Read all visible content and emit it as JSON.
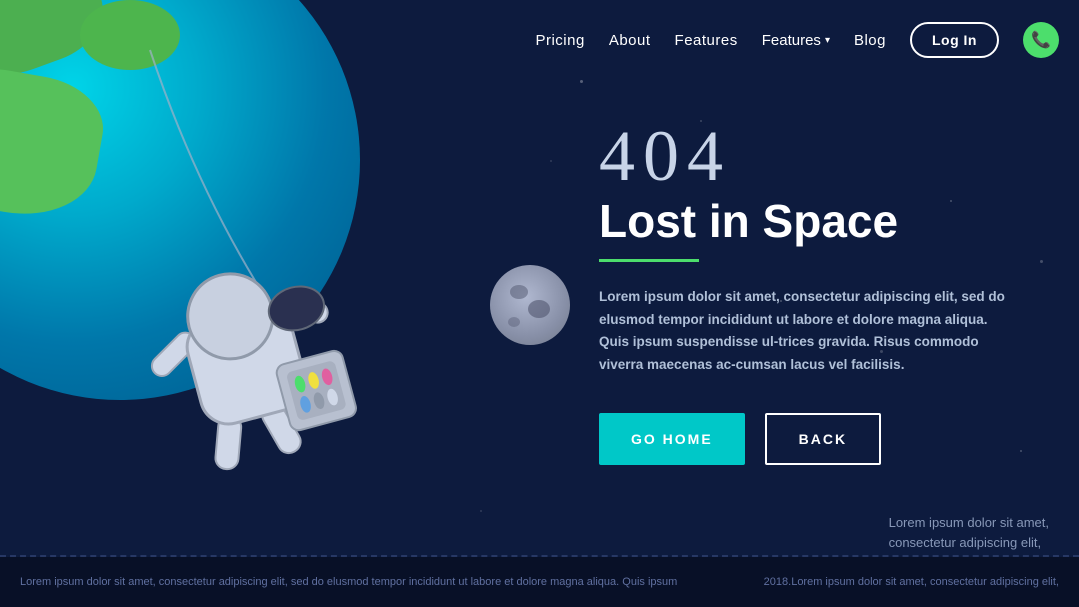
{
  "nav": {
    "links": [
      {
        "label": "Pricing",
        "id": "pricing"
      },
      {
        "label": "About",
        "id": "about"
      },
      {
        "label": "Features",
        "id": "features"
      },
      {
        "label": "Features",
        "id": "features-dropdown",
        "hasDropdown": true
      },
      {
        "label": "Blog",
        "id": "blog"
      }
    ],
    "login_label": "Log In",
    "phone_icon": "📞"
  },
  "hero": {
    "error_code": "404",
    "title": "Lost in Space",
    "description": "Lorem ipsum dolor sit amet, consectetur adipiscing elit, sed do elusmod tempor incididunt ut labore et dolore magna aliqua. Quis ipsum suspendisse ultrices gravida. Risus commodo viverra maecenas accumsan lacus vel facilisis.",
    "btn_home": "GO  HOME",
    "btn_back": "BACK"
  },
  "footer": {
    "left_text": "Lorem ipsum dolor sit amet, consectetur adipiscing elit, sed do elusmod tempor incididunt ut labore et dolore magna aliqua. Quis ipsum",
    "right_text": "2018.Lorem ipsum dolor sit amet, consectetur adipiscing elit,",
    "overlay_line1": "Lorem ipsum dolor sit amet,",
    "overlay_line2": "consectetur adipiscing elit,"
  },
  "colors": {
    "bg": "#0d1b3e",
    "accent_green": "#4cde6c",
    "accent_teal": "#00c8c8",
    "nav_text": "#ffffff",
    "body_text": "#a0b0c8"
  }
}
